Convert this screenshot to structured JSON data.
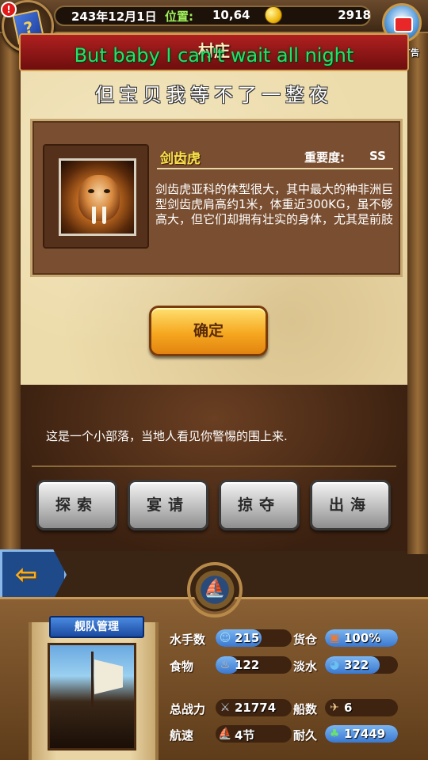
{
  "top_bar": {
    "date": "243年12月1日",
    "position_label": "位置:",
    "position_value": "10,64",
    "gold": "2918",
    "ad_label": "有新广告",
    "alert": "!",
    "book_glyph": "?"
  },
  "title": "村庄",
  "overlay_lyrics": {
    "english": "But baby I can't wait all night",
    "chinese": "但宝贝我等不了一整夜"
  },
  "creature": {
    "name": "剑齿虎",
    "importance_label": "重要度:",
    "importance_value": "SS",
    "description": "剑齿虎亚科的体型很大，其中最大的种非洲巨型剑齿虎肩高约1米，体重近300KG，虽不够高大，但它们却拥有壮实的身体，尤其是前肢"
  },
  "confirm_button": "确定",
  "message": "这是一个小部落，当地人看见你警惕的围上来.",
  "actions": [
    "探索",
    "宴请",
    "掠夺",
    "出海"
  ],
  "back_arrow": "⇦",
  "fleet": {
    "banner": "舰队管理",
    "helm_glyph": "⛵",
    "stats": [
      {
        "label": "水手数",
        "value": "215",
        "fill": 0.6,
        "icon": "sailor-icon"
      },
      {
        "label": "货仓",
        "value": "100%",
        "fill": 1.0,
        "icon": "cargo-icon"
      },
      {
        "label": "食物",
        "value": "122",
        "fill": 0.3,
        "icon": "food-icon"
      },
      {
        "label": "淡水",
        "value": "322",
        "fill": 0.75,
        "icon": "water-icon"
      },
      {
        "label": "总战力",
        "value": "21774",
        "fill": 0,
        "icon": "power-icon"
      },
      {
        "label": "船数",
        "value": "6",
        "fill": 0,
        "icon": "ship-count-icon"
      },
      {
        "label": "航速",
        "value": "4节",
        "fill": 0,
        "icon": "speed-icon"
      },
      {
        "label": "耐久",
        "value": "17449",
        "fill": 1.0,
        "icon": "durability-icon"
      }
    ]
  },
  "colors": {
    "accent_gold": "#f7e24a",
    "lyric_green": "#26e06a",
    "bar_blue": "#3a78d0"
  }
}
